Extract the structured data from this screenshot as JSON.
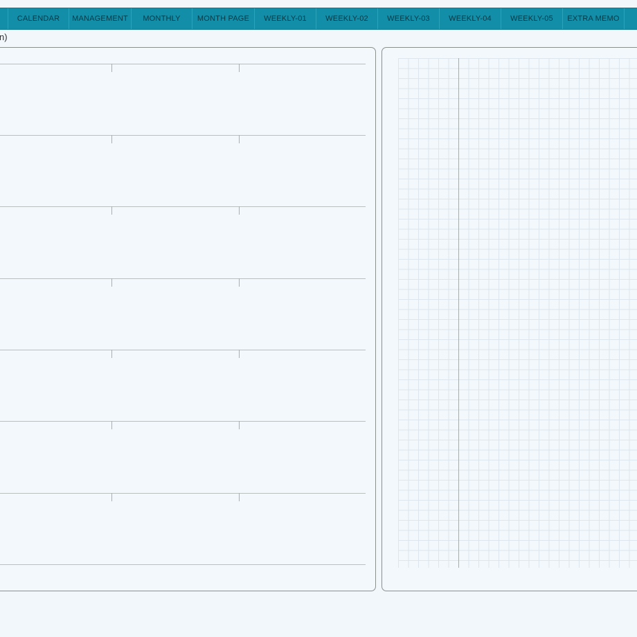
{
  "tabs": [
    {
      "label": ""
    },
    {
      "label": "CALENDAR"
    },
    {
      "label": "MANAGEMENT"
    },
    {
      "label": "MONTHLY"
    },
    {
      "label": "MONTH PAGE"
    },
    {
      "label": "WEEKLY-01"
    },
    {
      "label": "WEEKLY-02"
    },
    {
      "label": "WEEKLY-03"
    },
    {
      "label": "WEEKLY-04"
    },
    {
      "label": "WEEKLY-05"
    },
    {
      "label": "EXTRA MEMO"
    },
    {
      "label": ""
    }
  ],
  "page": {
    "subtitle_fragment": "n)"
  },
  "colors": {
    "tabbar": "#128ea8",
    "tab_text": "#083844",
    "background": "#f1f7fa",
    "panel_border": "#8a918d",
    "grid_line": "#dde6ec"
  }
}
